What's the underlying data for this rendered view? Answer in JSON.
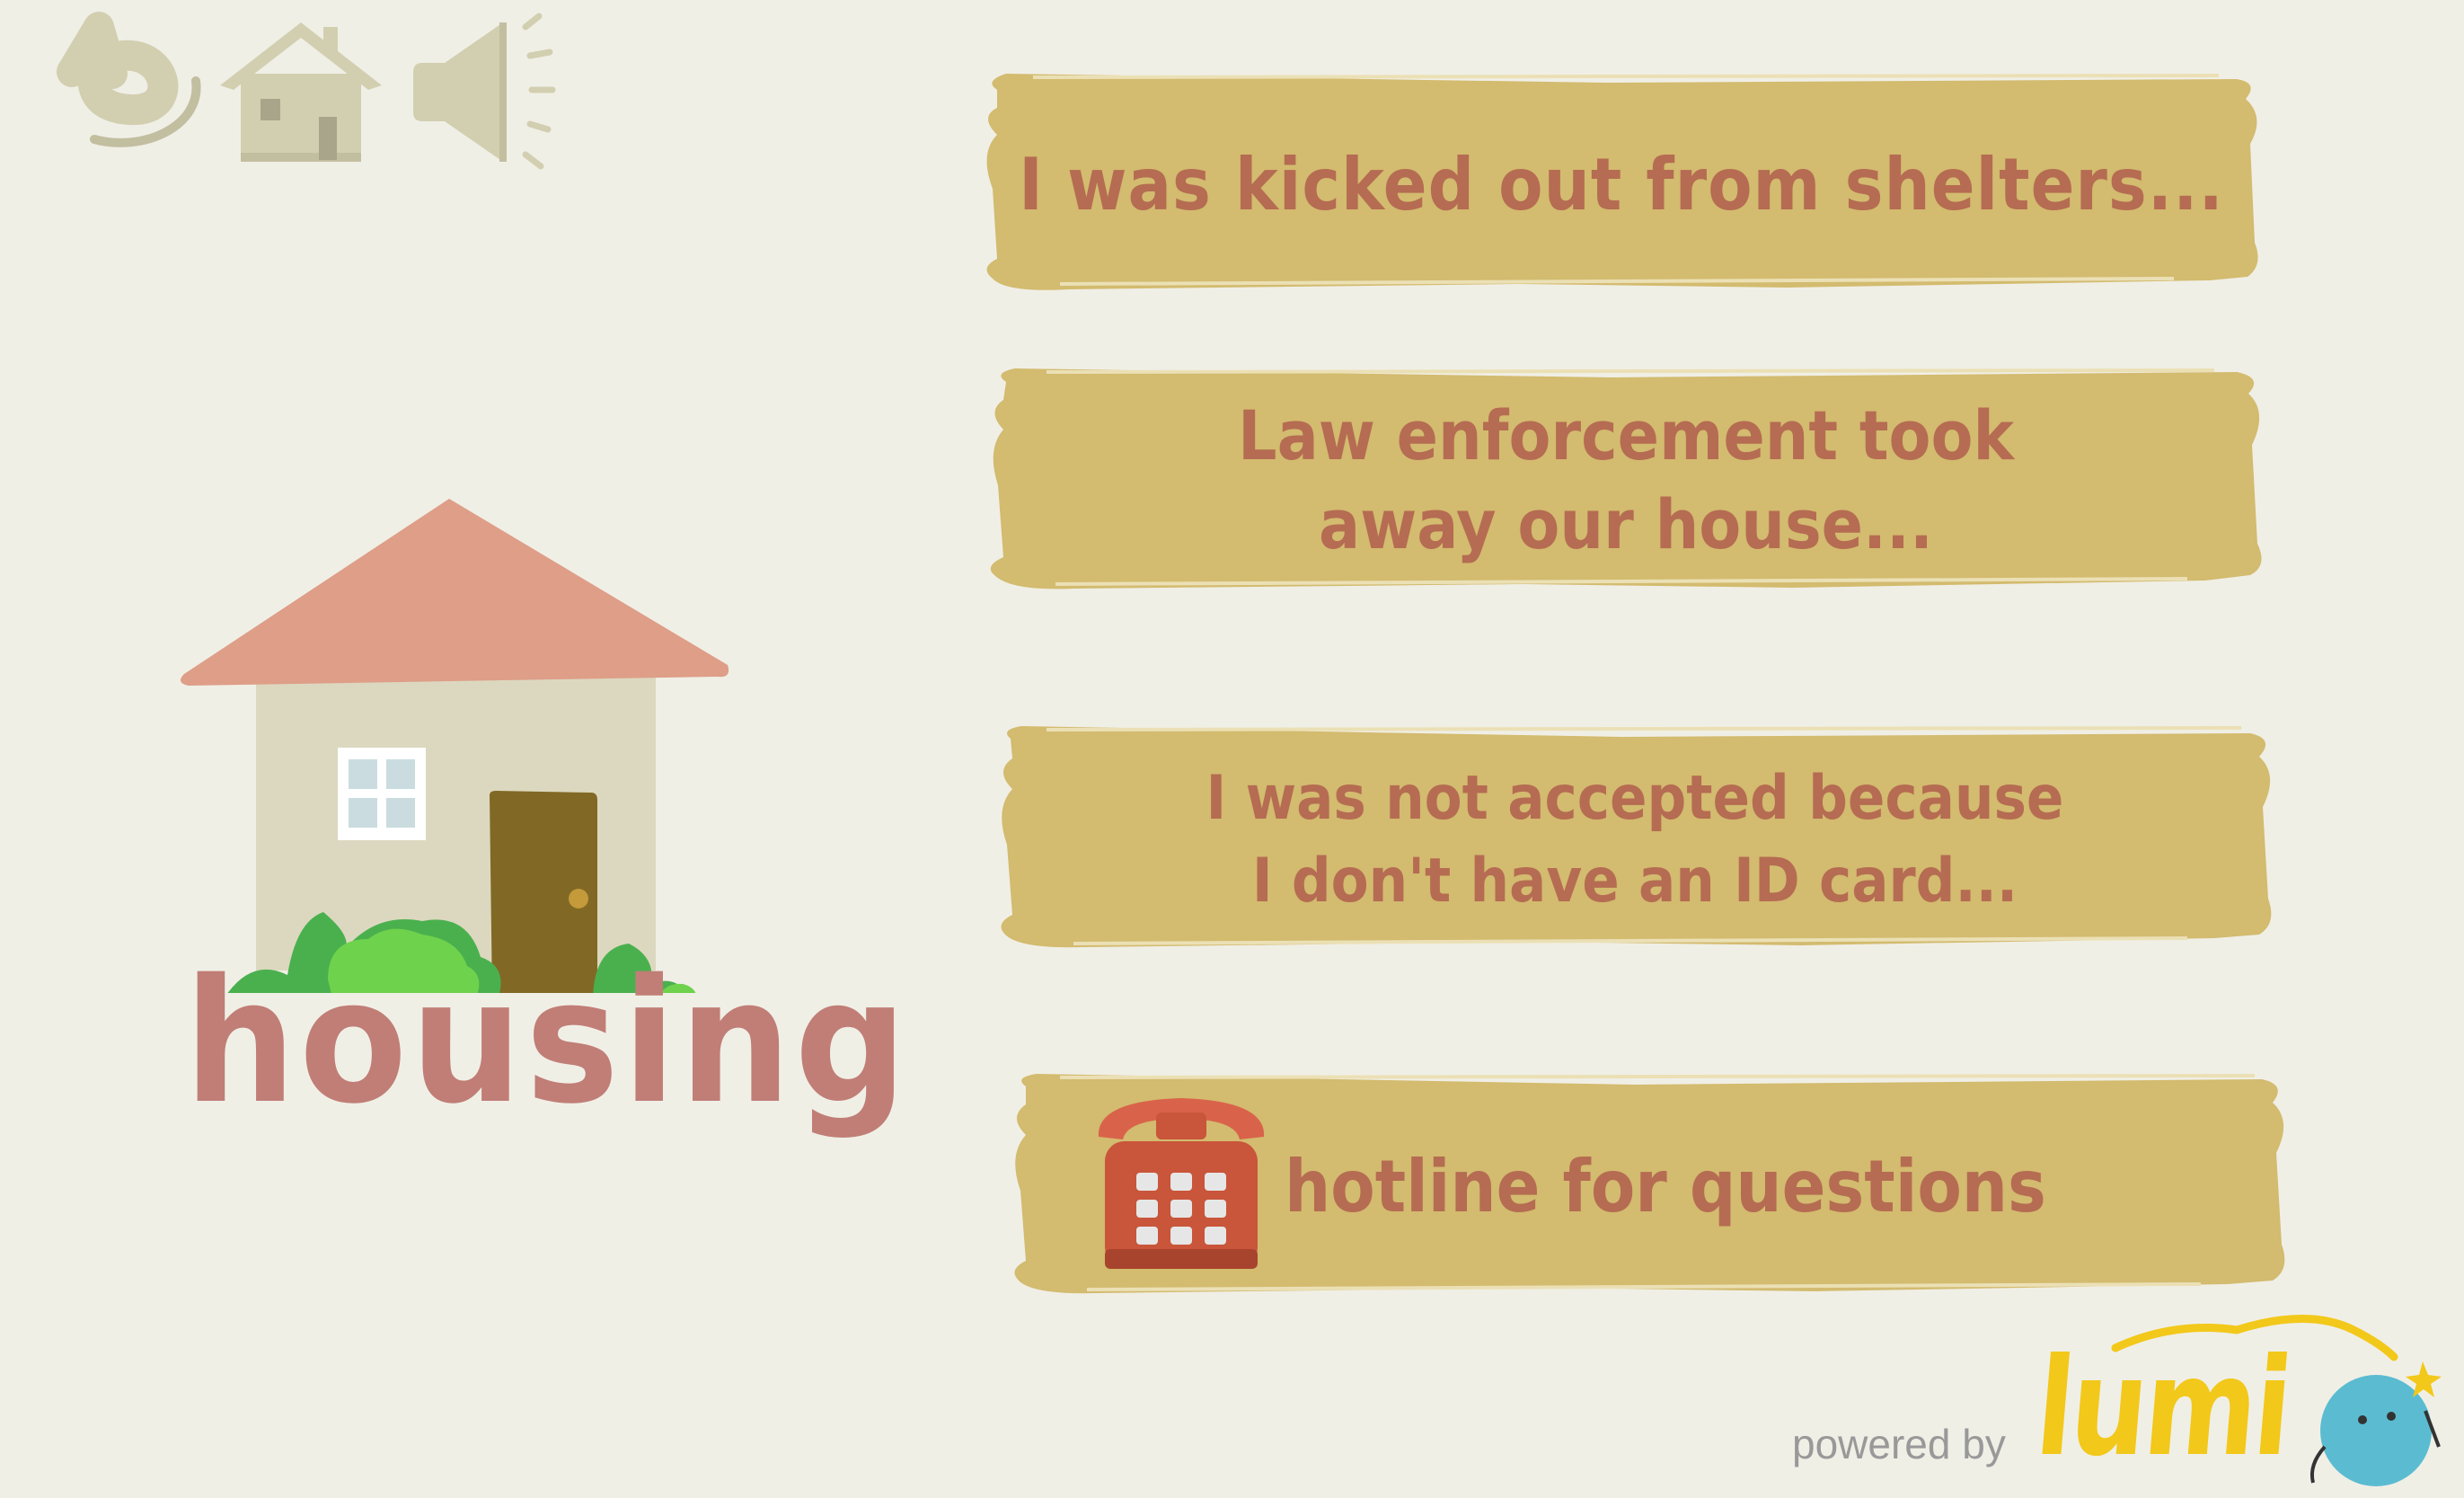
{
  "toolbar": {
    "back_icon": "undo-arrow-icon",
    "home_icon": "house-icon",
    "sound_icon": "speaker-icon"
  },
  "category": {
    "title": "housing",
    "illustration": "house-with-bushes-icon"
  },
  "options": [
    {
      "label": "I was kicked out from shelters..."
    },
    {
      "label": "Law enforcement took\naway our house..."
    },
    {
      "label": "I was not accepted because\nI don't have an ID card..."
    },
    {
      "label": "hotline for questions",
      "icon": "telephone-icon"
    }
  ],
  "footer": {
    "powered_by": "powered by",
    "brand": "lumi"
  },
  "colors": {
    "background": "#f0efe6",
    "button": "#d3bb6f",
    "button_text": "#b56c52",
    "title": "#c07e76",
    "toolbar_icon": "#d2cfb1",
    "brand": "#f2c81a",
    "mascot": "#5bbcd1"
  }
}
